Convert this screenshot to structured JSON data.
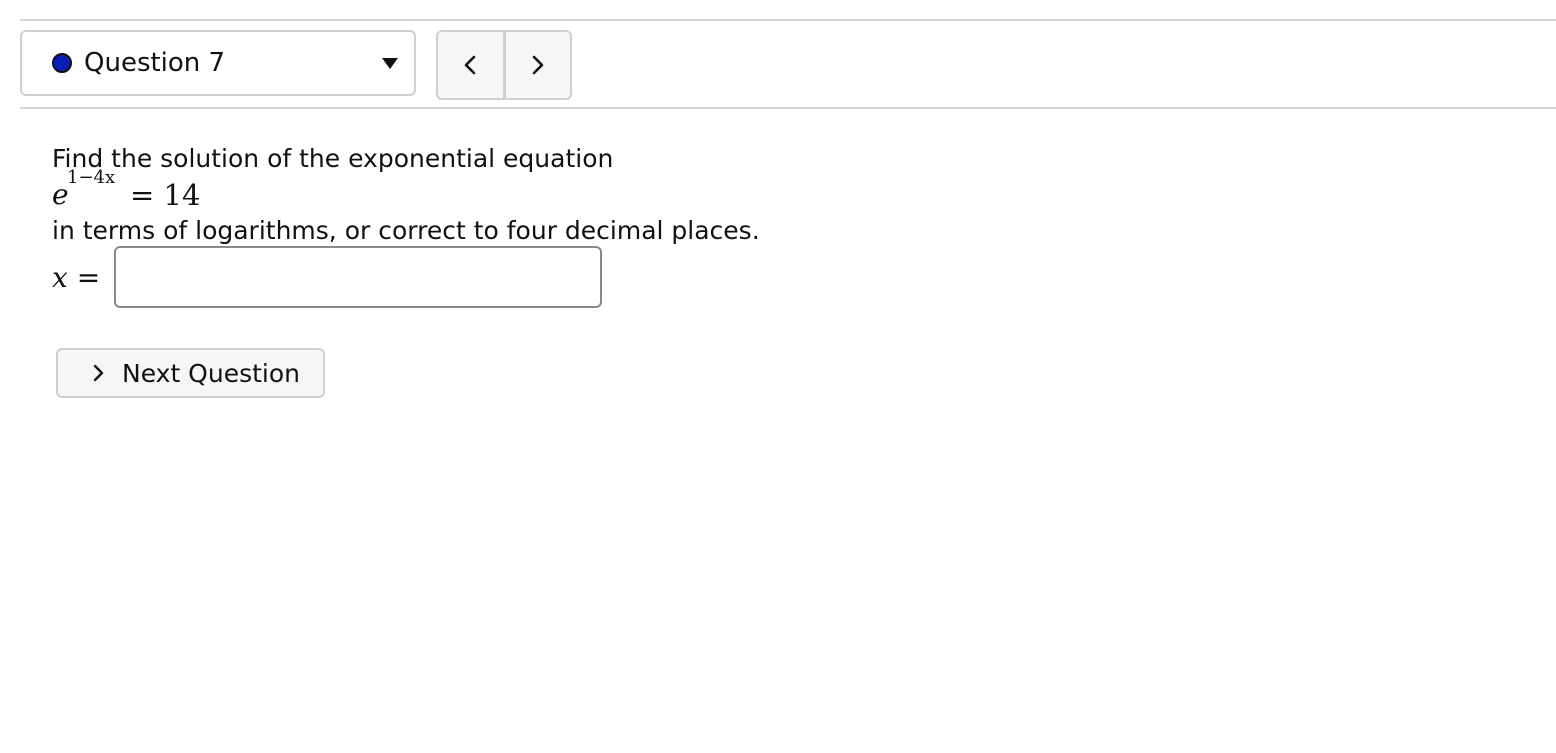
{
  "header": {
    "question_selector": {
      "label": "Question 7",
      "status_color": "#0a1fb5",
      "dropdown_icon": "caret-down-icon"
    },
    "nav": {
      "prev_icon": "chevron-left-icon",
      "next_icon": "chevron-right-icon"
    }
  },
  "problem": {
    "intro": "Find the solution of the exponential equation",
    "equation": {
      "base": "e",
      "exponent": "1−4x",
      "rhs": "= 14"
    },
    "instruction": "in terms of logarithms, or correct to four decimal places."
  },
  "answer": {
    "label": "x =",
    "value": "",
    "placeholder": ""
  },
  "actions": {
    "next_question_label": "Next Question",
    "next_question_icon": "chevron-right-icon"
  }
}
